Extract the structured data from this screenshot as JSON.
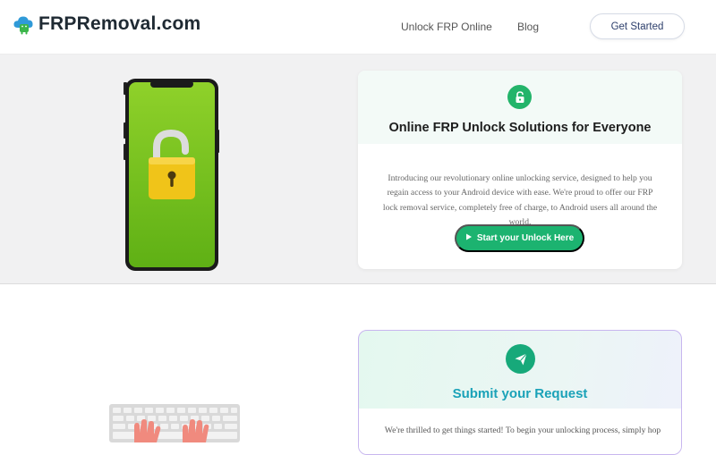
{
  "header": {
    "logo_text": "FRPRemoval.com",
    "nav": [
      {
        "label": "Unlock FRP Online"
      },
      {
        "label": "Blog"
      }
    ],
    "cta_label": "Get Started"
  },
  "hero": {
    "title": "Online FRP Unlock Solutions for Everyone",
    "description": "Introducing our revolutionary online unlocking service, designed to help you regain access to your Android device with ease. We're proud to offer our FRP lock removal service, completely free of charge, to Android users all around the world.",
    "button_label": "Start your Unlock Here",
    "icons": {
      "badge": "lock-open-icon",
      "button": "play-icon",
      "illustration": "phone-padlock-icon"
    }
  },
  "request": {
    "title": "Submit your Request",
    "description": "We're thrilled to get things started! To begin your unlocking process, simply hop",
    "icons": {
      "badge": "paper-plane-icon",
      "illustration": "keyboard-hands-icon"
    }
  },
  "colors": {
    "accent_green": "#1cb370",
    "title_teal": "#1aa2b8",
    "phone_green": "#7cc620",
    "padlock_yellow": "#f0c419"
  }
}
